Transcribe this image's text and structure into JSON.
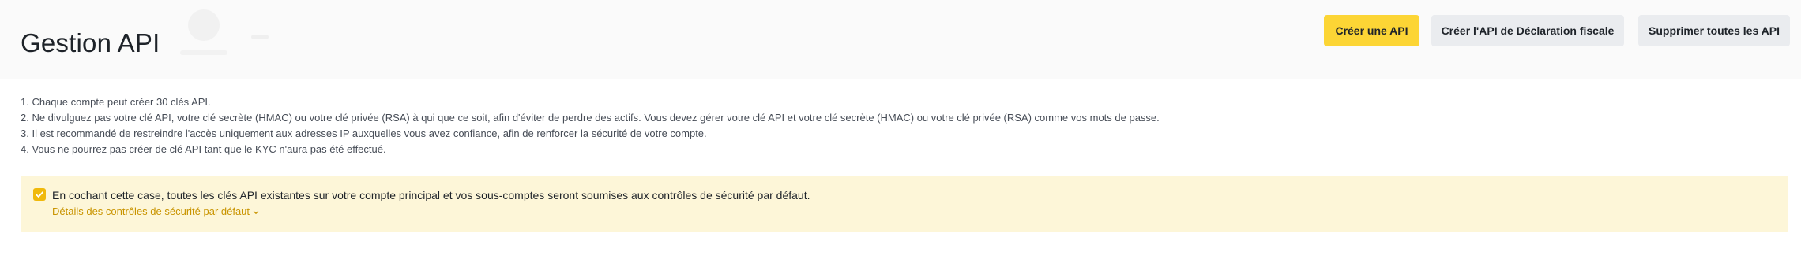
{
  "header": {
    "title": "Gestion API",
    "buttons": {
      "create": "Créer une API",
      "tax": "Créer l'API de Déclaration fiscale",
      "delete_all": "Supprimer toutes les API"
    }
  },
  "notes": [
    "1. Chaque compte peut créer 30 clés API.",
    "2. Ne divulguez pas votre clé API, votre clé secrète (HMAC) ou votre clé privée (RSA) à qui que ce soit, afin d'éviter de perdre des actifs. Vous devez gérer votre clé API et votre clé secrète (HMAC) ou votre clé privée (RSA) comme vos mots de passe.",
    "3. Il est recommandé de restreindre l'accès uniquement aux adresses IP auxquelles vous avez confiance, afin de renforcer la sécurité de votre compte.",
    "4. Vous ne pourrez pas créer de clé API tant que le KYC n'aura pas été effectué."
  ],
  "banner": {
    "checked": true,
    "text": "En cochant cette case, toutes les clés API existantes sur votre compte principal et vos sous-comptes seront soumises aux contrôles de sécurité par défaut.",
    "link": "Détails des contrôles de sécurité par défaut"
  },
  "colors": {
    "primary": "#fcd535",
    "secondary": "#eaecef",
    "banner_bg": "#fdf6d8",
    "checkbox": "#f0b90b",
    "link": "#c99400"
  }
}
